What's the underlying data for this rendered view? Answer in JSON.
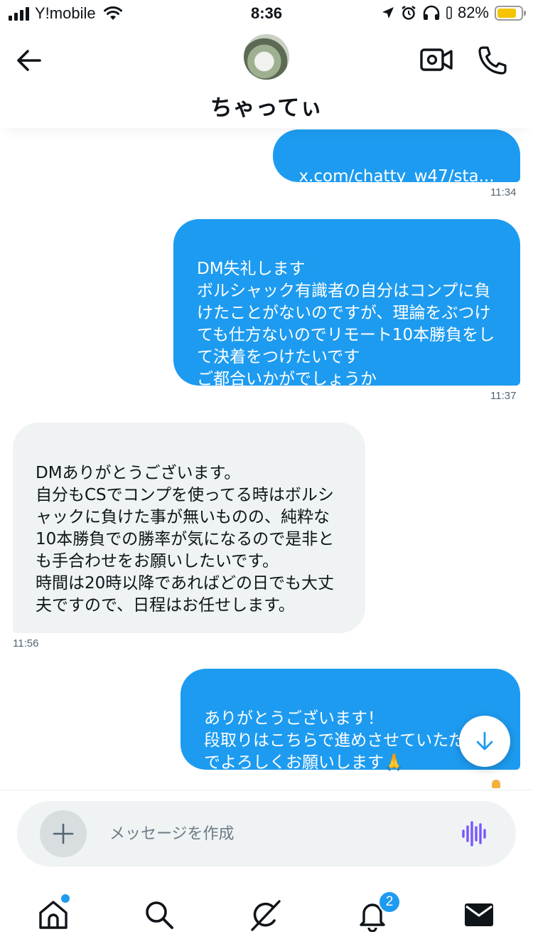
{
  "status_bar": {
    "carrier": "Y!mobile",
    "time": "8:36",
    "battery_percent": "82%",
    "battery_level": 0.82,
    "battery_color": "#f5c400"
  },
  "header": {
    "contact_name": "ちゃってぃ",
    "icons": [
      "back-arrow-icon",
      "avatar",
      "video-camera-icon",
      "phone-icon"
    ]
  },
  "messages": [
    {
      "direction": "outgoing",
      "link": "x.com/chatty_w47/sta...",
      "time": "11:34"
    },
    {
      "direction": "outgoing",
      "text": "DM失礼します\nボルシャック有識者の自分はコンプに負けたことがないのですが、理論をぶつけても仕方ないのでリモート10本勝負をして決着をつけたいです\nご都合いかがでしょうか",
      "time": "11:37"
    },
    {
      "direction": "incoming",
      "text": "DMありがとうございます。\n自分もCSでコンプを使ってる時はボルシャックに負けた事が無いものの、純粋な10本勝負での勝率が気になるので是非とも手合わせをお願いしたいです。\n時間は20時以降であればどの日でも大丈夫ですので、日程はお任せします。",
      "time": "11:56"
    },
    {
      "direction": "outgoing",
      "text": "ありがとうございます！\n段取りはこちらで進めさせていただくのでよろしくお願いします🙏"
    }
  ],
  "composer": {
    "placeholder": "メッセージを作成"
  },
  "tab_bar": {
    "tabs": [
      "home-icon",
      "search-icon",
      "grok-icon",
      "notifications-icon",
      "messages-icon"
    ],
    "notification_count": "2",
    "active_tab": "messages-icon"
  },
  "colors": {
    "accent": "#1d9bf0",
    "incoming_bubble": "#eff3f4",
    "voice_icon": "#7856ff"
  }
}
